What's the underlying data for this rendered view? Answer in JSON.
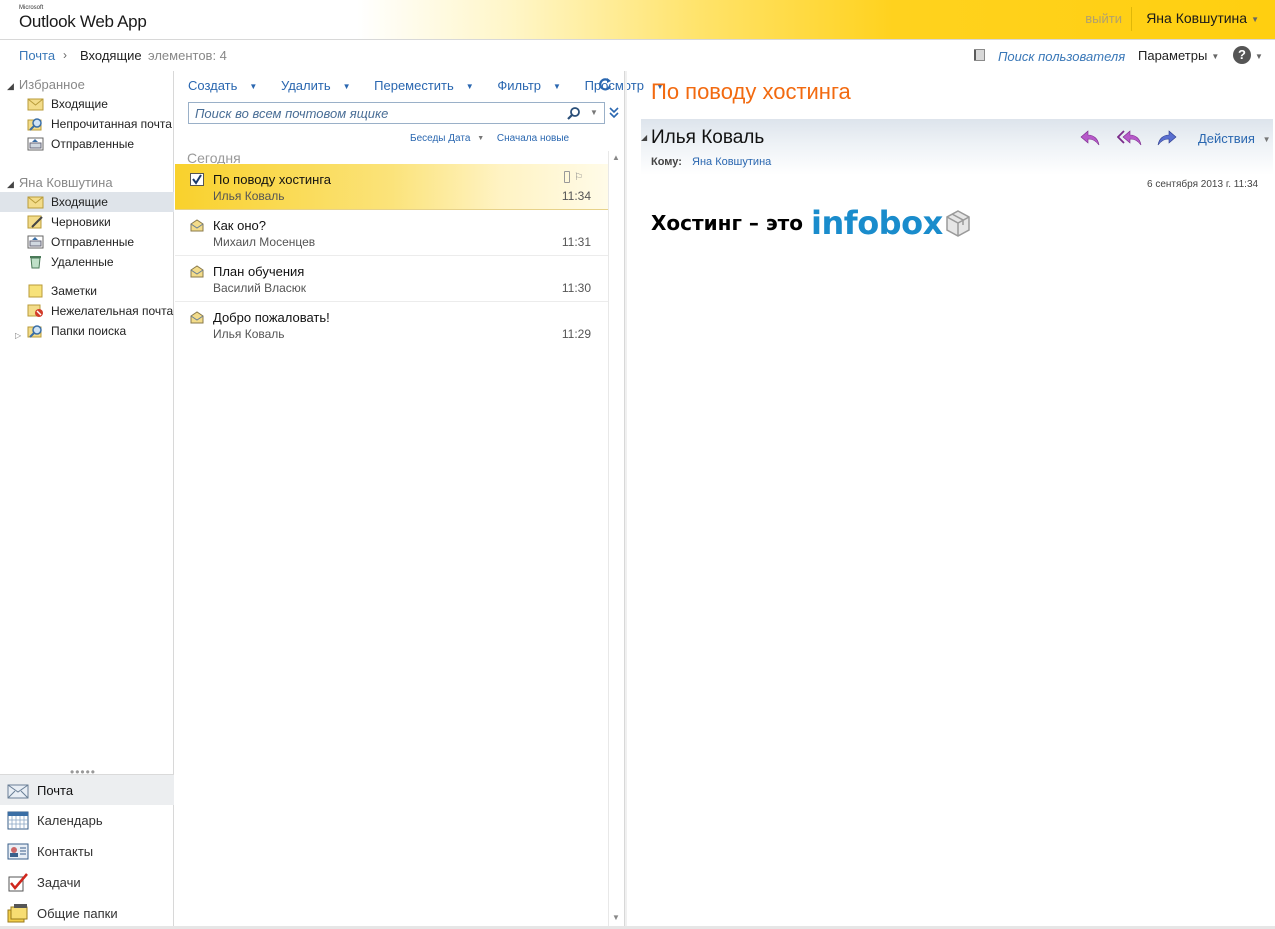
{
  "header": {
    "brand_ms": "Microsoft",
    "brand_name": "Outlook Web App",
    "logout": "выйти",
    "username": "Яна Ковшутина"
  },
  "breadcrumb": {
    "root": "Почта",
    "current": "Входящие",
    "count": "элементов: 4",
    "find_user": "Поиск пользователя",
    "params": "Параметры",
    "help": "?"
  },
  "nav": {
    "favorites_title": "Избранное",
    "favorites": [
      {
        "label": "Входящие",
        "icon": "inbox-icon"
      },
      {
        "label": "Непрочитанная почта",
        "icon": "search-folder-icon"
      },
      {
        "label": "Отправленные",
        "icon": "sent-icon"
      }
    ],
    "mailbox_title": "Яна Ковшутина",
    "folders": [
      {
        "label": "Входящие",
        "icon": "inbox-icon",
        "selected": true
      },
      {
        "label": "Черновики",
        "icon": "drafts-icon"
      },
      {
        "label": "Отправленные",
        "icon": "sent-icon"
      },
      {
        "label": "Удаленные",
        "icon": "trash-icon"
      },
      {
        "label": "Заметки",
        "icon": "notes-icon"
      },
      {
        "label": "Нежелательная почта",
        "icon": "junk-icon"
      },
      {
        "label": "Папки поиска",
        "icon": "search-folder-icon"
      }
    ],
    "bottom": [
      {
        "label": "Почта",
        "icon": "mail-icon",
        "selected": true
      },
      {
        "label": "Календарь",
        "icon": "calendar-icon"
      },
      {
        "label": "Контакты",
        "icon": "contacts-icon"
      },
      {
        "label": "Задачи",
        "icon": "tasks-icon"
      },
      {
        "label": "Общие папки",
        "icon": "public-folders-icon"
      }
    ]
  },
  "list": {
    "toolbar": {
      "create": "Создать",
      "delete": "Удалить",
      "move": "Переместить",
      "filter": "Фильтр",
      "view": "Просмотр"
    },
    "search_placeholder": "Поиск во всем почтовом ящике",
    "sort": {
      "by": "Беседы Дата",
      "order": "Сначала новые"
    },
    "group": "Сегодня",
    "messages": [
      {
        "subject": "По поводу хостинга",
        "from": "Илья Коваль",
        "time": "11:34",
        "selected": true
      },
      {
        "subject": "Как оно?",
        "from": "Михаил Мосенцев",
        "time": "11:31"
      },
      {
        "subject": "План обучения",
        "from": "Василий Власюк",
        "time": "11:30"
      },
      {
        "subject": "Добро пожаловать!",
        "from": "Илья Коваль",
        "time": "11:29"
      }
    ]
  },
  "reading": {
    "subject": "По поводу хостинга",
    "sender": "Илья Коваль",
    "to_label": "Кому:",
    "to": "Яна Ковшутина",
    "actions": "Действия",
    "date": "6 сентября 2013 г. 11:34",
    "body_text": "Хостинг – это",
    "logo_text": "infobox"
  },
  "colors": {
    "accent_orange": "#f26a10",
    "link_blue": "#2a67b0",
    "selection_yellow": "#f9d12c",
    "logo_blue": "#1a8ccc"
  }
}
